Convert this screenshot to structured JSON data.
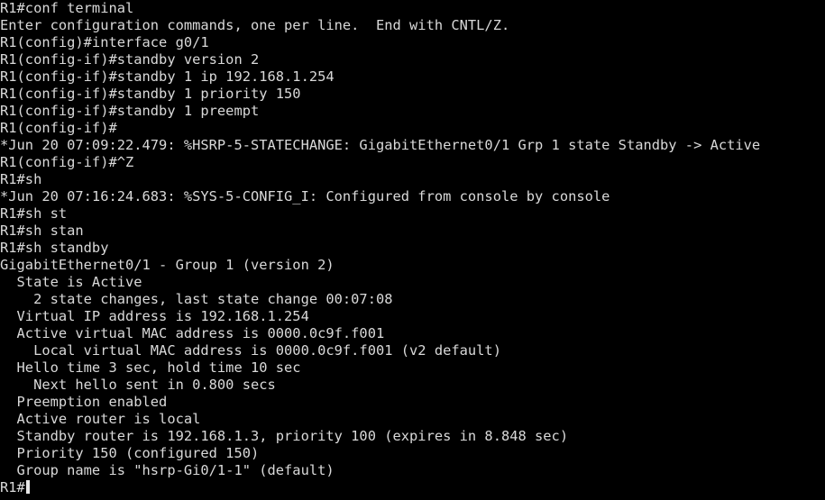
{
  "terminal": {
    "lines": [
      "R1#conf terminal",
      "Enter configuration commands, one per line.  End with CNTL/Z.",
      "R1(config)#interface g0/1",
      "R1(config-if)#standby version 2",
      "R1(config-if)#standby 1 ip 192.168.1.254",
      "R1(config-if)#standby 1 priority 150",
      "R1(config-if)#standby 1 preempt",
      "R1(config-if)#",
      "*Jun 20 07:09:22.479: %HSRP-5-STATECHANGE: GigabitEthernet0/1 Grp 1 state Standby -> Active",
      "R1(config-if)#^Z",
      "R1#sh",
      "*Jun 20 07:16:24.683: %SYS-5-CONFIG_I: Configured from console by console",
      "R1#sh st",
      "R1#sh stan",
      "R1#sh standby",
      "GigabitEthernet0/1 - Group 1 (version 2)",
      "  State is Active",
      "    2 state changes, last state change 00:07:08",
      "  Virtual IP address is 192.168.1.254",
      "  Active virtual MAC address is 0000.0c9f.f001",
      "    Local virtual MAC address is 0000.0c9f.f001 (v2 default)",
      "  Hello time 3 sec, hold time 10 sec",
      "    Next hello sent in 0.800 secs",
      "  Preemption enabled",
      "  Active router is local",
      "  Standby router is 192.168.1.3, priority 100 (expires in 8.848 sec)",
      "  Priority 150 (configured 150)",
      "  Group name is \"hsrp-Gi0/1-1\" (default)"
    ],
    "current_prompt": "R1#"
  }
}
